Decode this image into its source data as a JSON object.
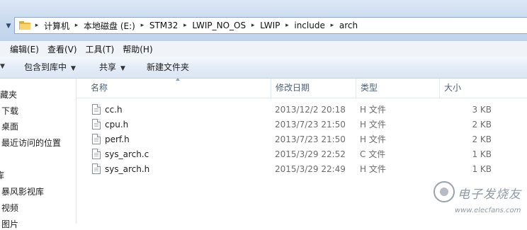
{
  "address": {
    "crumbs": [
      "计算机",
      "本地磁盘 (E:)",
      "STM32",
      "LWIP_NO_OS",
      "LWIP",
      "include",
      "arch"
    ]
  },
  "menu": [
    "编辑(E)",
    "查看(V)",
    "工具(T)",
    "帮助(H)"
  ],
  "toolbar": {
    "include_library": "包含到库中",
    "share": "共享",
    "new_folder": "新建文件夹"
  },
  "nav": {
    "items": [
      "藏夹",
      "下载",
      "桌面",
      "最近访问的位置",
      "库",
      "暴风影视库",
      "视频",
      "图片"
    ]
  },
  "columns": {
    "name": "名称",
    "date": "修改日期",
    "type": "类型",
    "size": "大小"
  },
  "files": [
    {
      "name": "cc.h",
      "date": "2013/12/2 20:18",
      "type": "H 文件",
      "size": "3 KB"
    },
    {
      "name": "cpu.h",
      "date": "2013/7/23 21:50",
      "type": "H 文件",
      "size": "2 KB"
    },
    {
      "name": "perf.h",
      "date": "2013/7/23 21:50",
      "type": "H 文件",
      "size": "2 KB"
    },
    {
      "name": "sys_arch.c",
      "date": "2015/3/29 22:52",
      "type": "C 文件",
      "size": "1 KB"
    },
    {
      "name": "sys_arch.h",
      "date": "2015/3/29 22:49",
      "type": "H 文件",
      "size": "1 KB"
    }
  ],
  "watermark": {
    "title": "电子发烧友",
    "url": "www.elecfans.com"
  }
}
